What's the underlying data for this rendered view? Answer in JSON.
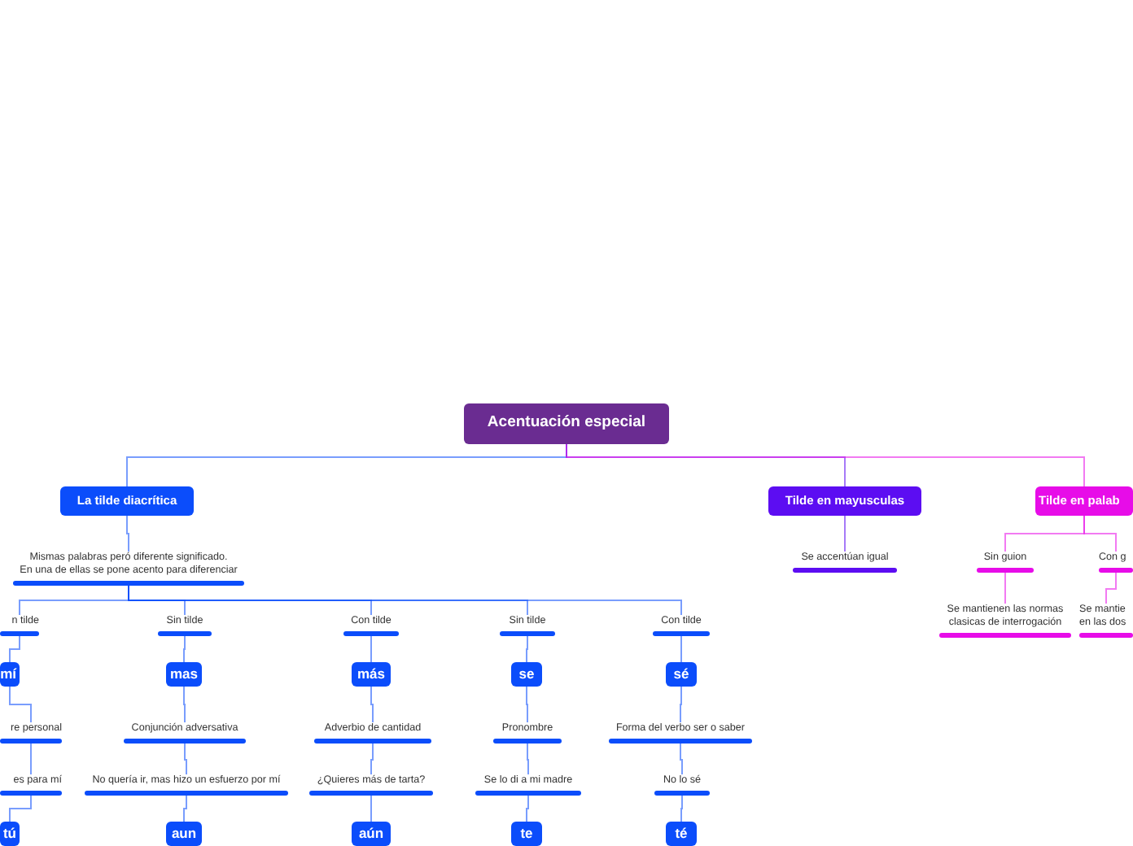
{
  "root": {
    "kind": "topic",
    "label": "Acentuación especial",
    "color": "#6a2c91",
    "children": [
      {
        "kind": "topic",
        "label": "La tilde diacrítica",
        "color": "#0b4dfb",
        "children": [
          {
            "kind": "note",
            "label": "Mismas palabras peró diferente significado.\nEn una de ellas se pone acento para diferenciar",
            "children": [
              {
                "kind": "note",
                "label": "n tilde",
                "children": [
                  {
                    "kind": "topic",
                    "label": "mí",
                    "children": [
                      {
                        "kind": "note",
                        "label": "re personal",
                        "children": [
                          {
                            "kind": "note",
                            "label": "es para mí",
                            "children": [
                              {
                                "kind": "topic",
                                "label": "tú"
                              }
                            ]
                          }
                        ]
                      }
                    ]
                  }
                ]
              },
              {
                "kind": "note",
                "label": "Sin tilde",
                "children": [
                  {
                    "kind": "topic",
                    "label": "mas",
                    "children": [
                      {
                        "kind": "note",
                        "label": "Conjunción adversativa",
                        "children": [
                          {
                            "kind": "note",
                            "label": "No quería ir, mas hizo un esfuerzo por mí",
                            "children": [
                              {
                                "kind": "topic",
                                "label": "aun"
                              }
                            ]
                          }
                        ]
                      }
                    ]
                  }
                ]
              },
              {
                "kind": "note",
                "label": "Con tilde",
                "children": [
                  {
                    "kind": "topic",
                    "label": "más",
                    "children": [
                      {
                        "kind": "note",
                        "label": "Adverbio de cantidad",
                        "children": [
                          {
                            "kind": "note",
                            "label": "¿Quieres más de tarta?",
                            "children": [
                              {
                                "kind": "topic",
                                "label": "aún"
                              }
                            ]
                          }
                        ]
                      }
                    ]
                  }
                ]
              },
              {
                "kind": "note",
                "label": "Sin tilde",
                "children": [
                  {
                    "kind": "topic",
                    "label": "se",
                    "children": [
                      {
                        "kind": "note",
                        "label": "Pronombre",
                        "children": [
                          {
                            "kind": "note",
                            "label": "Se lo di a mi madre",
                            "children": [
                              {
                                "kind": "topic",
                                "label": "te"
                              }
                            ]
                          }
                        ]
                      }
                    ]
                  }
                ]
              },
              {
                "kind": "note",
                "label": "Con tilde",
                "children": [
                  {
                    "kind": "topic",
                    "label": "sé",
                    "children": [
                      {
                        "kind": "note",
                        "label": "Forma del verbo ser o saber",
                        "children": [
                          {
                            "kind": "note",
                            "label": "No lo sé",
                            "children": [
                              {
                                "kind": "topic",
                                "label": "té"
                              }
                            ]
                          }
                        ]
                      }
                    ]
                  }
                ]
              }
            ]
          }
        ]
      },
      {
        "kind": "topic",
        "label": "Tilde en mayusculas",
        "color": "#5c0df2",
        "children": [
          {
            "kind": "note",
            "label": "Se accentúan igual"
          }
        ]
      },
      {
        "kind": "topic",
        "label": "Tilde en palab",
        "color": "#e70ce8",
        "children": [
          {
            "kind": "note",
            "label": "Sin guion",
            "children": [
              {
                "kind": "note",
                "label": "Se mantienen las normas\nclasicas de interrogación"
              }
            ]
          },
          {
            "kind": "note",
            "label": "Con g",
            "children": [
              {
                "kind": "note",
                "label": "Se mantie\nen las dos"
              }
            ]
          }
        ]
      }
    ]
  }
}
